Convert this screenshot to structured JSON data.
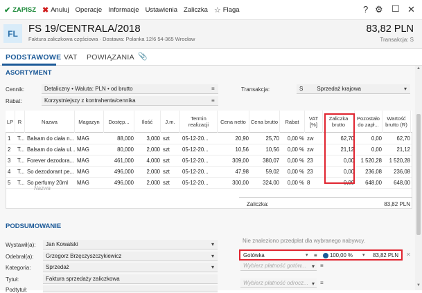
{
  "toolbar": {
    "save": "ZAPISZ",
    "cancel": "Anuluj",
    "operations": "Operacje",
    "info": "Informacje",
    "settings": "Ustawienia",
    "advance": "Zaliczka",
    "flag": "Flaga"
  },
  "header": {
    "badge": "FL",
    "title": "FS 19/CENTRALA/2018",
    "subtitle": "Faktura zaliczkowa częściowa · Dostawa: Polanka 12/6 54-365 Wrocław",
    "amount": "83,82 PLN",
    "transaction": "Transakcja: S"
  },
  "tabs": [
    "PODSTAWOWE",
    "VAT",
    "POWIĄZANIA"
  ],
  "assortment": {
    "section": "ASORTYMENT",
    "price_list_label": "Cennik:",
    "price_list": "Detaliczny • Waluta: PLN • od brutto",
    "discount_label": "Rabat:",
    "discount": "Korzystniejszy z kontrahenta/cennika",
    "transaction_label": "Transakcja:",
    "transaction_code": "S",
    "transaction_value": "Sprzedaż krajowa",
    "columns": [
      "LP",
      "R",
      "Nazwa",
      "Magazyn",
      "Dostęp...",
      "Ilość",
      "J.m.",
      "Termin realizacji",
      "Cena netto",
      "Cena brutto",
      "Rabat",
      "VAT [%]",
      "Zaliczka brutto",
      "Pozostało do zapł...",
      "Wartość brutto (R)"
    ],
    "rows": [
      [
        "1",
        "T...",
        "Balsam do ciała n...",
        "MAG",
        "88,000",
        "3,000",
        "szt",
        "05-12-20...",
        "20,90",
        "25,70",
        "0,00 %",
        "zw",
        "62,70",
        "0,00",
        "62,70"
      ],
      [
        "2",
        "T...",
        "Balsam do ciała ul...",
        "MAG",
        "80,000",
        "2,000",
        "szt",
        "05-12-20...",
        "10,56",
        "10,56",
        "0,00 %",
        "zw",
        "21,12",
        "0,00",
        "21,12"
      ],
      [
        "3",
        "T...",
        "Forever dezodora...",
        "MAG",
        "461,000",
        "4,000",
        "szt",
        "05-12-20...",
        "309,00",
        "380,07",
        "0,00 %",
        "23",
        "0,00",
        "1 520,28",
        "1 520,28"
      ],
      [
        "4",
        "T...",
        "So dezodorant pe...",
        "MAG",
        "496,000",
        "2,000",
        "szt",
        "05-12-20...",
        "47,98",
        "59,02",
        "0,00 %",
        "23",
        "0,00",
        "236,08",
        "236,08"
      ],
      [
        "5",
        "T...",
        "So perfumy 20ml",
        "MAG",
        "496,000",
        "2,000",
        "szt",
        "05-12-20...",
        "300,00",
        "324,00",
        "0,00 %",
        "8",
        "0,00",
        "648,00",
        "648,00"
      ]
    ],
    "new_row_placeholder": "Nazwa",
    "advance_label": "Zaliczka:",
    "advance_value": "83,82 PLN"
  },
  "summary": {
    "section": "PODSUMOWANIE",
    "issued_label": "Wystawił(a):",
    "issued": "Jan Kowalski",
    "received_label": "Odebrał(a):",
    "received": "Grzegorz Brzęczyszczykiewicz",
    "category_label": "Kategoria:",
    "category": "Sprzedaż",
    "title_label": "Tytuł:",
    "title": "Faktura sprzedaży zaliczkowa",
    "extra_label": "Podtytuł:",
    "no_prepayments": "Nie znaleziono przedpłat dla wybranego nabywcy.",
    "payment_method": "Gotówka",
    "payment_percent": "100,00 %",
    "payment_amount": "83,82 PLN",
    "payment_placeholder1": "Wybierz płatność gotów...",
    "payment_placeholder2": "Wybierz płatność odrocz..."
  },
  "colors": {
    "accent": "#1c5a98",
    "highlight": "#e0242f",
    "save": "#1d8a3a"
  }
}
